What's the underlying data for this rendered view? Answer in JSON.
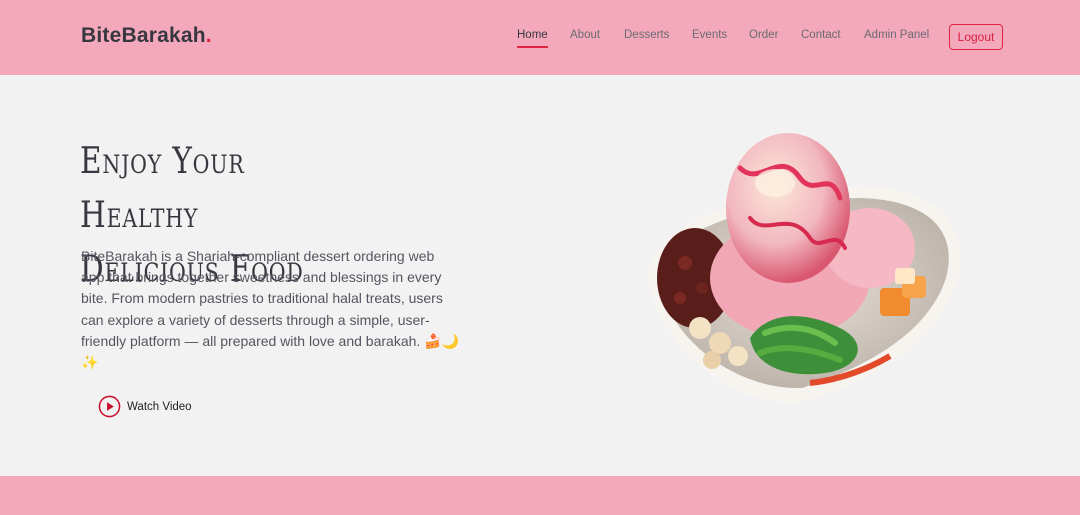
{
  "header": {
    "logo_text": "BiteBarakah",
    "logo_dot": ".",
    "nav": [
      {
        "label": "Home",
        "active": true
      },
      {
        "label": "About"
      },
      {
        "label": "Desserts"
      },
      {
        "label": "Events"
      },
      {
        "label": "Order"
      },
      {
        "label": "Contact"
      },
      {
        "label": "Admin Panel"
      }
    ],
    "logout_label": "Logout"
  },
  "hero": {
    "title": "Enjoy Your Healthy Delicious Food",
    "description": "BiteBarakah is a Shariah-compliant dessert ordering web app that brings together sweetness and blessings in every bite. From modern pastries to traditional halal treats, users can explore a variety of desserts through a simple, user-friendly platform — all prepared with love and barakah. 🍰🌙✨",
    "watch_label": "Watch Video",
    "image_icon": "dessert-bowl-image"
  },
  "colors": {
    "header_bg": "#f4a8bc",
    "accent": "#e02442",
    "page_bg": "#f2f2f2",
    "text_dark": "#37373f"
  }
}
